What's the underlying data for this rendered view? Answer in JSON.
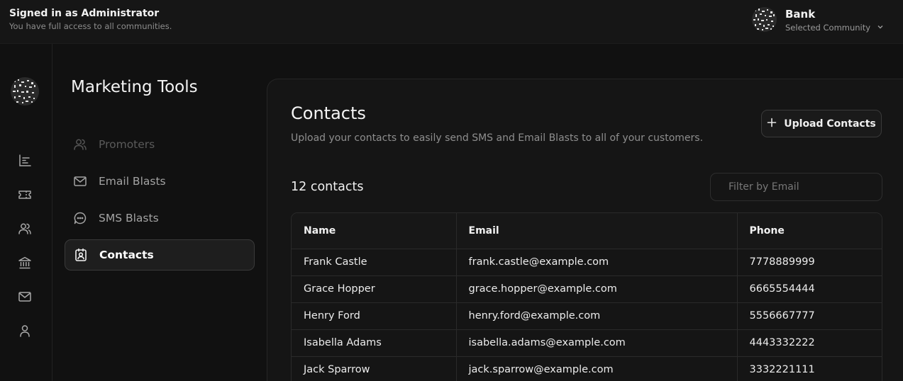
{
  "header": {
    "signed_in_title": "Signed in as Administrator",
    "signed_in_sub": "You have full access to all communities.",
    "community_name": "Bank",
    "community_label": "Selected Community"
  },
  "sidebar": {
    "title": "Marketing Tools",
    "items": [
      {
        "label": "Promoters",
        "icon": "users-icon",
        "state": "disabled"
      },
      {
        "label": "Email Blasts",
        "icon": "mail-icon",
        "state": "normal"
      },
      {
        "label": "SMS Blasts",
        "icon": "message-circle-icon",
        "state": "normal"
      },
      {
        "label": "Contacts",
        "icon": "contact-card-icon",
        "state": "active"
      }
    ]
  },
  "rail": {
    "icons": [
      "bar-chart-icon",
      "ticket-icon",
      "users-icon",
      "bank-icon",
      "mail-icon",
      "user-icon"
    ]
  },
  "main": {
    "title": "Contacts",
    "subtitle": "Upload your contacts to easily send SMS and Email Blasts to all of your customers.",
    "upload_label": "Upload Contacts",
    "count_text": "12 contacts",
    "filter_placeholder": "Filter by Email",
    "table": {
      "columns": [
        "Name",
        "Email",
        "Phone"
      ],
      "rows": [
        {
          "name": "Frank Castle",
          "email": "frank.castle@example.com",
          "phone": "7778889999"
        },
        {
          "name": "Grace Hopper",
          "email": "grace.hopper@example.com",
          "phone": "6665554444"
        },
        {
          "name": "Henry Ford",
          "email": "henry.ford@example.com",
          "phone": "5556667777"
        },
        {
          "name": "Isabella Adams",
          "email": "isabella.adams@example.com",
          "phone": "4443332222"
        },
        {
          "name": "Jack Sparrow",
          "email": "jack.sparrow@example.com",
          "phone": "3332221111"
        }
      ]
    }
  },
  "colors": {
    "background": "#111111",
    "card": "#151515",
    "border": "#2a2a2a",
    "text_primary": "#f0f0f0",
    "text_muted": "#8e8e8e"
  }
}
